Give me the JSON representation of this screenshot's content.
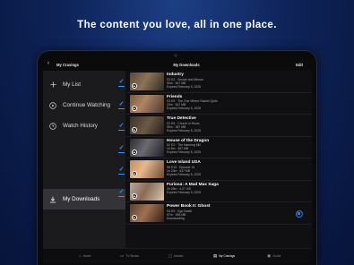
{
  "headline": "The content you love, all in one place.",
  "topbar": {
    "back_icon": "‹",
    "left_label": "My Cravings",
    "center_title": "My Downloads",
    "right_label": "Edit"
  },
  "sidebar": {
    "items": [
      {
        "label": "My List",
        "icon": "plus-icon"
      },
      {
        "label": "Continue Watching",
        "icon": "play-circle-icon"
      },
      {
        "label": "Watch History",
        "icon": "clock-icon"
      },
      {
        "label": "My Downloads",
        "icon": "download-icon",
        "active": true
      }
    ]
  },
  "downloads": [
    {
      "title": "Industry",
      "line1": "S3 E2 · Smoke and Mirrors",
      "line2": "59m · 647 MB",
      "line3": "Expires February 5, 2025",
      "status": "downloaded"
    },
    {
      "title": "Friends",
      "line1": "S3 E9 · The One Where Rachel Quits",
      "line2": "23m · 647 MB",
      "line3": "Expires February 5, 2025",
      "status": "downloaded"
    },
    {
      "title": "True Detective",
      "line1": "S2 E8 · Church In Ruins",
      "line2": "59m · 387 MB",
      "line3": "Expires February 5, 2025",
      "status": "downloaded"
    },
    {
      "title": "House of the Dragon",
      "line1": "S2 E2 · The Harming Mill",
      "line2": "1h 8m · 387 MB",
      "line3": "Expires February 5, 2025",
      "status": "downloaded"
    },
    {
      "title": "Love Island USA",
      "line1": "S6 E15 · Episode 15",
      "line2": "1h 23m · 647 MB",
      "line3": "Expires February 5, 2025",
      "status": "downloaded"
    },
    {
      "title": "Furiosa: A Mad Max Saga",
      "line1": "2h 28m · 4.27 GB",
      "line2": "Expires February 5, 2025",
      "line3": "",
      "status": "downloaded"
    },
    {
      "title": "Power Book II: Ghost",
      "line1": "S4 E5 · Ego Death",
      "line2": "57m · 398 MB",
      "line3": "Downloading",
      "status": "downloading"
    }
  ],
  "bottom_nav": [
    {
      "label": "Home",
      "icon": "home-icon"
    },
    {
      "label": "TV Shows",
      "icon": "tv-icon"
    },
    {
      "label": "Movies",
      "icon": "film-icon"
    },
    {
      "label": "My Cravings",
      "icon": "bookmark-icon",
      "active": true
    },
    {
      "label": "Go Ad",
      "icon": "ad-icon"
    }
  ],
  "colors": {
    "accent": "#3f8ef5",
    "background_top": "#1c3f85",
    "background_bottom": "#07143a"
  }
}
